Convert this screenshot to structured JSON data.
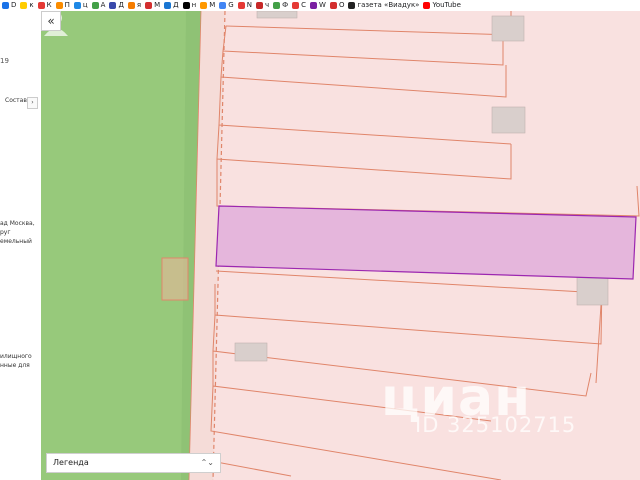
{
  "bookmarks": [
    {
      "label": "D",
      "color": "#1a73e8"
    },
    {
      "label": "к",
      "color": "#ffcc00"
    },
    {
      "label": "К",
      "color": "#e53935"
    },
    {
      "label": "П",
      "color": "#fb8c00"
    },
    {
      "label": "ц",
      "color": "#1e88e5"
    },
    {
      "label": "А",
      "color": "#43a047"
    },
    {
      "label": "Д",
      "color": "#3949ab"
    },
    {
      "label": "я",
      "color": "#f57c00"
    },
    {
      "label": "М",
      "color": "#d32f2f"
    },
    {
      "label": "Д",
      "color": "#1976d2"
    },
    {
      "label": "н",
      "color": "#000000"
    },
    {
      "label": "М",
      "color": "#ff9800"
    },
    {
      "label": "G",
      "color": "#4285f4"
    },
    {
      "label": "N",
      "color": "#e53935"
    },
    {
      "label": "ч",
      "color": "#c62828"
    },
    {
      "label": "Ф",
      "color": "#43a047"
    },
    {
      "label": "С",
      "color": "#e53935"
    },
    {
      "label": "W",
      "color": "#7b1fa2"
    },
    {
      "label": "О",
      "color": "#d32f2f"
    },
    {
      "label": "газета «Виадук»",
      "color": "#222222"
    },
    {
      "label": "YouTube",
      "color": "#ff0000"
    }
  ],
  "left_panel": {
    "number": "19",
    "structure_label": "Состав",
    "expand_icon": "›",
    "line1": "ад Москва,",
    "line2": "руг",
    "line3": "емельный",
    "line4": "илищного",
    "line5": "нные для"
  },
  "map": {
    "collapse_label": "«",
    "legend_label": "Легенда",
    "legend_arrows": "⌃⌄",
    "watermark_brand": "циан",
    "watermark_id": "ID 325102715",
    "colors": {
      "forest": "#97c97b",
      "parcel_fill": "#f9e1e0",
      "parcel_border": "#e0856a",
      "selected_fill": "#e5b6dc",
      "selected_border": "#9c27b0",
      "building": "#d9cfcc"
    }
  }
}
